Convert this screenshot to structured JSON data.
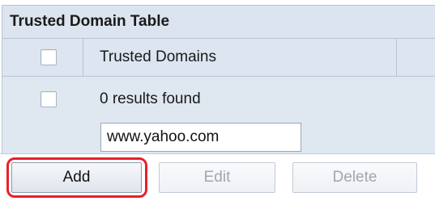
{
  "table": {
    "title": "Trusted Domain Table",
    "column_header": "Trusted Domains",
    "results_text": "0 results found",
    "domain_input_value": "www.yahoo.com",
    "domain_input_placeholder": ""
  },
  "buttons": {
    "add_label": "Add",
    "edit_label": "Edit",
    "delete_label": "Delete"
  },
  "annotation": {
    "highlight_color": "#e8202a",
    "highlighted_control": "Add"
  },
  "colors": {
    "header_background": "#dbe4ef",
    "row_background": "#dfe7f1",
    "disabled_text": "#a0a7b0"
  }
}
